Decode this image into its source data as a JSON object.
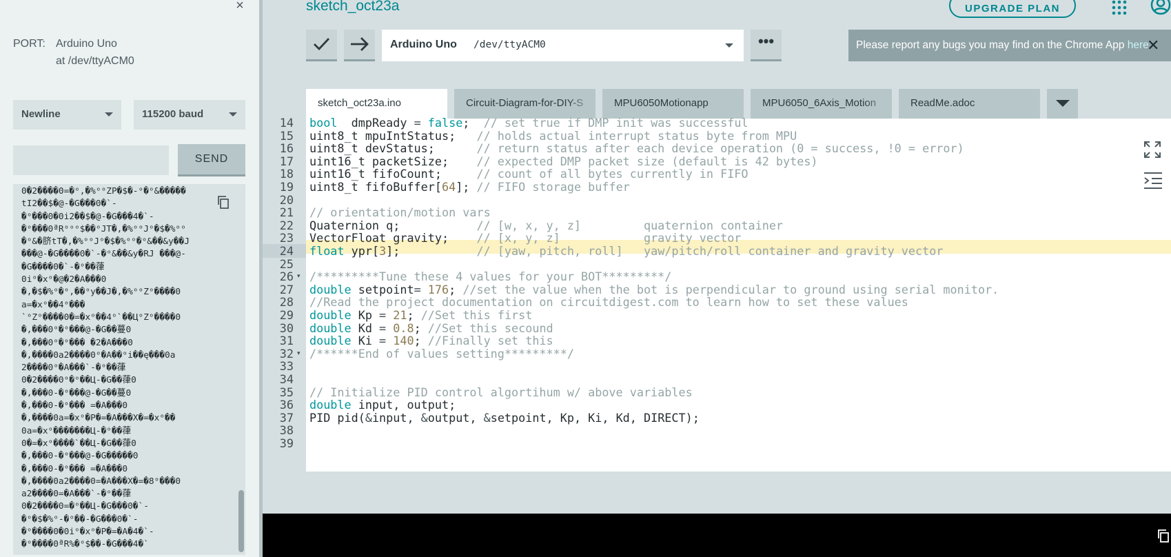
{
  "serial_monitor": {
    "close_symbol": "×",
    "port_label": "PORT:",
    "port_name": "Arduino Uno",
    "port_path": "at /dev/ttyACM0",
    "line_ending": "Newline",
    "baud_rate": "115200 baud",
    "send_input_value": "",
    "send_label": "SEND",
    "output_lines": [
      "0�2����0=�ᵒ,�%ᵒᵒZP�$�-ᵒ�ᵒ&�����",
      "tI2��$�@-�G���0�`-",
      "�ᵒ���0�0i2��$�@-�G���4�`-",
      "�ᵒ���0ªRᵒᵒᵒ$��ᵒJT�,�%ᵒᵒJᵒ�$�%ᵒᵒ",
      "�ᵒ&�脐tT�,�%ᵒᵒJᵒ�$�%ᵒᵒ�ᵒ&��&y��J",
      "���@-�G����0�`-�ᵒ&��&y�RJ ���@-",
      "�G����0�`-�ᵒ��葎",
      "0iᵒ�xᵒ�@�2�A���0",
      "�,�$�%ᵒ�ᵒ,��ᵒy��J�,�%ᵒᵒZᵒ����0",
      "a=�xᵒ��4ᵒ���",
      "`ᵒZᵒ����0�=�xᵒ��4ᵒ`��ЦᵒZᵒ����0",
      "�,���0ᵒ�ᵒ���@-�G��蔓0",
      "�,���0ᵒ�ᵒ��� �2�A���0",
      "�,����0a2����0ᵒ�A��ᵒi��ę���0a",
      "2����0ᵒ�A���`-�ᵒ��葎",
      "0�2����0ᵒ�ᵒ��Ц-�G��葎0",
      "�,���0-�ᵒ���@-�G��蔓0",
      "�,���0-�ᵒ��� =�A���0",
      "�,����0a=�xᵒ�P�=�A���X�=�xᵒ��",
      "0a=�xᵒ�������Ц-�ᵒ��葎",
      "0�=�xᵒ����`��Ц-�G��葎0",
      "�,���0-�ᵒ���@-�G�����0",
      "�,���0-�ᵒ��� =�A���0",
      "�,����0a2����0=�A���X�=�8ᵒ���0",
      "a2����0=�A���`-�ᵒ��葎",
      "0�2����0=�ᵒ��Ц-�G���0�`-",
      "�ᵒ�$�%ᵒ-�ᵒ��-�G���0�`-",
      "�ᵒ����0�0iᵒ�xᵒ�P�=�A�4�`-",
      "�ᵒ����0ªR%�ᵒ$��-�G���4�`"
    ]
  },
  "header": {
    "sketch_title": "sketch_oct23a",
    "upgrade_label": "UPGRADE PLAN"
  },
  "toolbar": {
    "board_name": "Arduino Uno",
    "board_port": "/dev/ttyACM0",
    "more_symbol": "•••"
  },
  "banner": {
    "text": "Please report any bugs you may find on the Chrome App ",
    "link": "here",
    "close_symbol": "✕"
  },
  "tabs": [
    {
      "label": "sketch_oct23a.ino",
      "active": true
    },
    {
      "label": "Circuit-Diagram-for-DIY-S",
      "active": false
    },
    {
      "label": "MPU6050Motionapp",
      "active": false
    },
    {
      "label": "MPU6050_6Axis_Motion",
      "active": false
    },
    {
      "label": "ReadMe.adoc",
      "active": false
    }
  ],
  "editor": {
    "current_line": 24,
    "highlighted_line": 23,
    "lines": [
      {
        "n": "14",
        "tokens": [
          [
            "kw",
            "bool"
          ],
          [
            "",
            "  dmpReady "
          ],
          [
            "op",
            "="
          ],
          [
            "kw",
            " false"
          ],
          [
            "",
            ";  "
          ],
          [
            "cm",
            "// set true if DMP init was successful"
          ]
        ]
      },
      {
        "n": "15",
        "tokens": [
          [
            "",
            "uint8_t mpuIntStatus;   "
          ],
          [
            "cm",
            "// holds actual interrupt status byte from MPU"
          ]
        ]
      },
      {
        "n": "16",
        "tokens": [
          [
            "",
            "uint8_t devStatus;      "
          ],
          [
            "cm",
            "// return status after each device operation (0 = success, !0 = error)"
          ]
        ]
      },
      {
        "n": "17",
        "tokens": [
          [
            "",
            "uint16_t packetSize;    "
          ],
          [
            "cm",
            "// expected DMP packet size (default is 42 bytes)"
          ]
        ]
      },
      {
        "n": "18",
        "tokens": [
          [
            "",
            "uint16_t fifoCount;     "
          ],
          [
            "cm",
            "// count of all bytes currently in FIFO"
          ]
        ]
      },
      {
        "n": "19",
        "tokens": [
          [
            "",
            "uint8_t fifoBuffer["
          ],
          [
            "num",
            "64"
          ],
          [
            "",
            "]; "
          ],
          [
            "cm",
            "// FIFO storage buffer"
          ]
        ]
      },
      {
        "n": "20",
        "tokens": []
      },
      {
        "n": "21",
        "tokens": [
          [
            "cm",
            "// orientation/motion vars"
          ]
        ]
      },
      {
        "n": "22",
        "tokens": [
          [
            "",
            "Quaternion q;           "
          ],
          [
            "cm",
            "// [w, x, y, z]         quaternion container"
          ]
        ]
      },
      {
        "n": "23",
        "tokens": [
          [
            "",
            "VectorFloat gravity;    "
          ],
          [
            "cm",
            "// [x, y, z]            gravity vector"
          ]
        ]
      },
      {
        "n": "24",
        "tokens": [
          [
            "kw",
            "float"
          ],
          [
            "",
            " ypr["
          ],
          [
            "num",
            "3"
          ],
          [
            "",
            "];           "
          ],
          [
            "cm",
            "// [yaw, pitch, roll]   yaw/pitch/roll container and gravity vector"
          ]
        ]
      },
      {
        "n": "25",
        "tokens": []
      },
      {
        "n": "26",
        "fold": true,
        "tokens": [
          [
            "cm",
            "/*********Tune these 4 values for your BOT*********/"
          ]
        ]
      },
      {
        "n": "27",
        "tokens": [
          [
            "kw",
            "double"
          ],
          [
            "",
            " setpoint"
          ],
          [
            "op",
            "="
          ],
          [
            "",
            " "
          ],
          [
            "num",
            "176"
          ],
          [
            "",
            "; "
          ],
          [
            "cm",
            "//set the value when the bot is perpendicular to ground using serial monitor."
          ]
        ]
      },
      {
        "n": "28",
        "tokens": [
          [
            "cm",
            "//Read the project documentation on circuitdigest.com to learn how to set these values"
          ]
        ]
      },
      {
        "n": "29",
        "tokens": [
          [
            "kw",
            "double"
          ],
          [
            "",
            " Kp "
          ],
          [
            "op",
            "="
          ],
          [
            "",
            " "
          ],
          [
            "num",
            "21"
          ],
          [
            "",
            "; "
          ],
          [
            "cm",
            "//Set this first"
          ]
        ]
      },
      {
        "n": "30",
        "tokens": [
          [
            "kw",
            "double"
          ],
          [
            "",
            " Kd "
          ],
          [
            "op",
            "="
          ],
          [
            "",
            " "
          ],
          [
            "num",
            "0.8"
          ],
          [
            "",
            "; "
          ],
          [
            "cm",
            "//Set this secound"
          ]
        ]
      },
      {
        "n": "31",
        "tokens": [
          [
            "kw",
            "double"
          ],
          [
            "",
            " Ki "
          ],
          [
            "op",
            "="
          ],
          [
            "",
            " "
          ],
          [
            "num",
            "140"
          ],
          [
            "",
            "; "
          ],
          [
            "cm",
            "//Finally set this"
          ]
        ]
      },
      {
        "n": "32",
        "fold": true,
        "tokens": [
          [
            "cm",
            "/******End of values setting*********/"
          ]
        ]
      },
      {
        "n": "33",
        "tokens": []
      },
      {
        "n": "34",
        "tokens": []
      },
      {
        "n": "35",
        "tokens": [
          [
            "cm",
            "// Initialize PID control algortihum w/ above variables"
          ]
        ]
      },
      {
        "n": "36",
        "tokens": [
          [
            "kw",
            "double"
          ],
          [
            "",
            " input, output;"
          ]
        ]
      },
      {
        "n": "37",
        "tokens": [
          [
            "",
            "PID pid("
          ],
          [
            "op",
            "&"
          ],
          [
            "",
            "input, "
          ],
          [
            "op",
            "&"
          ],
          [
            "",
            "output, "
          ],
          [
            "op",
            "&"
          ],
          [
            "",
            "setpoint, Kp, Ki, Kd, DIRECT);"
          ]
        ]
      },
      {
        "n": "38",
        "tokens": []
      },
      {
        "n": "39",
        "tokens": []
      }
    ]
  },
  "colors": {
    "accent": "#00878f",
    "keyword": "#00979c",
    "comment": "#95a5a6",
    "number": "#8a7b52",
    "highlight": "#fcf2c2",
    "console": "#000000"
  },
  "icons": {
    "verify": "check-icon",
    "upload": "arrow-right-icon",
    "apps": "grid-icon",
    "account": "account-icon",
    "copy": "copy-icon",
    "expand": "expand-icon",
    "indent": "indent-icon"
  }
}
